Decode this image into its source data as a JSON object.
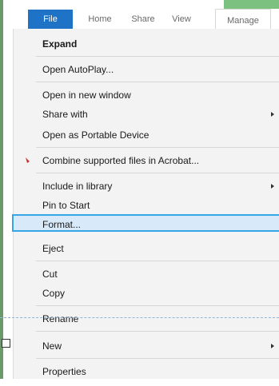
{
  "ribbon": {
    "tabs": [
      {
        "label": "File"
      },
      {
        "label": "Home"
      },
      {
        "label": "Share"
      },
      {
        "label": "View"
      },
      {
        "label": "Manage"
      }
    ]
  },
  "menu": {
    "items": [
      {
        "label": "Expand"
      },
      {
        "label": "Open AutoPlay..."
      },
      {
        "label": "Open in new window"
      },
      {
        "label": "Share with"
      },
      {
        "label": "Open as Portable Device"
      },
      {
        "label": "Combine supported files in Acrobat..."
      },
      {
        "label": "Include in library"
      },
      {
        "label": "Pin to Start"
      },
      {
        "label": "Format..."
      },
      {
        "label": "Eject"
      },
      {
        "label": "Cut"
      },
      {
        "label": "Copy"
      },
      {
        "label": "Rename"
      },
      {
        "label": "New"
      },
      {
        "label": "Properties"
      }
    ]
  },
  "colors": {
    "file_tab": "#1e73c6",
    "selection_border": "#35a6e6",
    "selection_fill": "#d8eaf9",
    "manage_accent": "#7cc17f"
  },
  "icons": {
    "acrobat": "acrobat-icon",
    "submenu_arrow": "chevron-right-icon"
  }
}
